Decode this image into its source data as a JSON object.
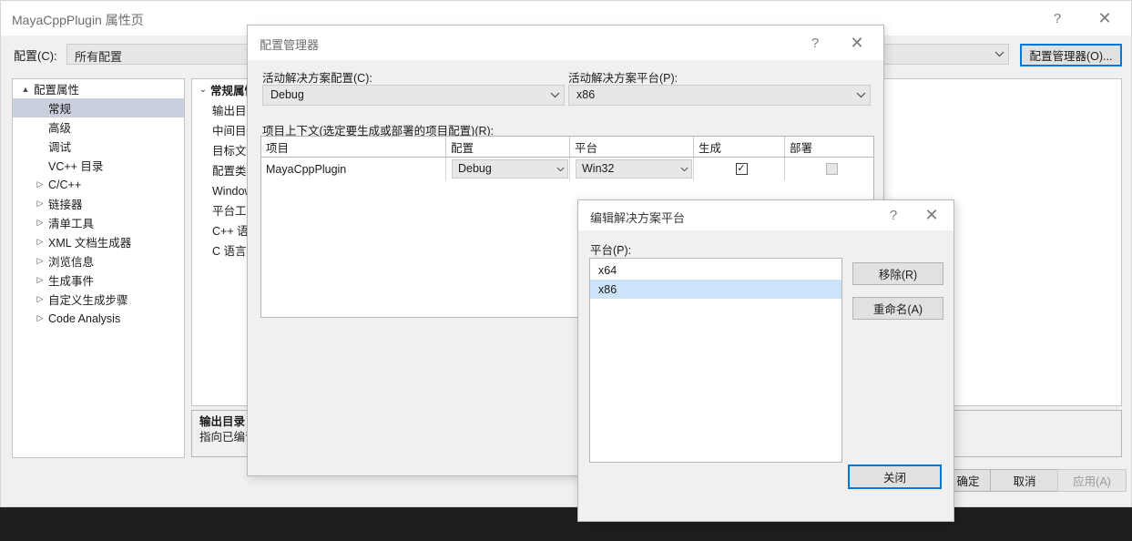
{
  "window": {
    "title": "MayaCppPlugin 属性页",
    "help_glyph": "?",
    "close_glyph": "✕"
  },
  "config_row": {
    "label": "配置(C):",
    "value": "所有配置",
    "manager_button": "配置管理器(O)...",
    "accent_color": "#0078d7"
  },
  "tree": {
    "items": [
      {
        "label": "配置属性",
        "level": 0,
        "twisty": "▲",
        "selected": false,
        "leaf": false
      },
      {
        "label": "常规",
        "level": 1,
        "twisty": "",
        "selected": true,
        "leaf": true
      },
      {
        "label": "高级",
        "level": 1,
        "twisty": "",
        "selected": false,
        "leaf": true
      },
      {
        "label": "调试",
        "level": 1,
        "twisty": "",
        "selected": false,
        "leaf": true
      },
      {
        "label": "VC++ 目录",
        "level": 1,
        "twisty": "",
        "selected": false,
        "leaf": true
      },
      {
        "label": "C/C++",
        "level": 1,
        "twisty": "▷",
        "selected": false,
        "leaf": false
      },
      {
        "label": "链接器",
        "level": 1,
        "twisty": "▷",
        "selected": false,
        "leaf": false
      },
      {
        "label": "清单工具",
        "level": 1,
        "twisty": "▷",
        "selected": false,
        "leaf": false
      },
      {
        "label": "XML 文档生成器",
        "level": 1,
        "twisty": "▷",
        "selected": false,
        "leaf": false
      },
      {
        "label": "浏览信息",
        "level": 1,
        "twisty": "▷",
        "selected": false,
        "leaf": false
      },
      {
        "label": "生成事件",
        "level": 1,
        "twisty": "▷",
        "selected": false,
        "leaf": false
      },
      {
        "label": "自定义生成步骤",
        "level": 1,
        "twisty": "▷",
        "selected": false,
        "leaf": false
      },
      {
        "label": "Code Analysis",
        "level": 1,
        "twisty": "▷",
        "selected": false,
        "leaf": false
      }
    ]
  },
  "grid": {
    "category": "常规属性",
    "category_chevron": "⌄",
    "rows": [
      {
        "name": "输出目录"
      },
      {
        "name": "中间目录"
      },
      {
        "name": "目标文件名"
      },
      {
        "name": "配置类型"
      },
      {
        "name": "Windows SDK 版本"
      },
      {
        "name": "平台工具集"
      },
      {
        "name": "C++ 语言标准"
      },
      {
        "name": "C 语言标准"
      }
    ]
  },
  "description": {
    "title": "输出目录",
    "body": "指向已编译"
  },
  "footer": {
    "ok": "确定",
    "cancel": "取消",
    "apply": "应用(A)"
  },
  "config_manager": {
    "title": "配置管理器",
    "help_glyph": "?",
    "close_glyph": "✕",
    "active_config_label": "活动解决方案配置(C):",
    "active_config_value": "Debug",
    "active_platform_label": "活动解决方案平台(P):",
    "active_platform_value": "x86",
    "project_context_label": "项目上下文(选定要生成或部署的项目配置)(R):",
    "table": {
      "headers": [
        "项目",
        "配置",
        "平台",
        "生成",
        "部署"
      ],
      "rows": [
        {
          "project": "MayaCppPlugin",
          "config": "Debug",
          "platform": "Win32",
          "build_checked": true,
          "build_glyph": "✓",
          "deploy_checked": false,
          "deploy_glyph": ""
        }
      ]
    }
  },
  "edit_platforms": {
    "title": "编辑解决方案平台",
    "help_glyph": "?",
    "close_glyph": "✕",
    "platforms_label": "平台(P):",
    "platforms": [
      {
        "name": "x64",
        "selected": false
      },
      {
        "name": "x86",
        "selected": true
      }
    ],
    "remove_button": "移除(R)",
    "rename_button": "重命名(A)",
    "close_button": "关闭",
    "selection_color": "#cce4fa",
    "focus_color": "#0078d7"
  }
}
